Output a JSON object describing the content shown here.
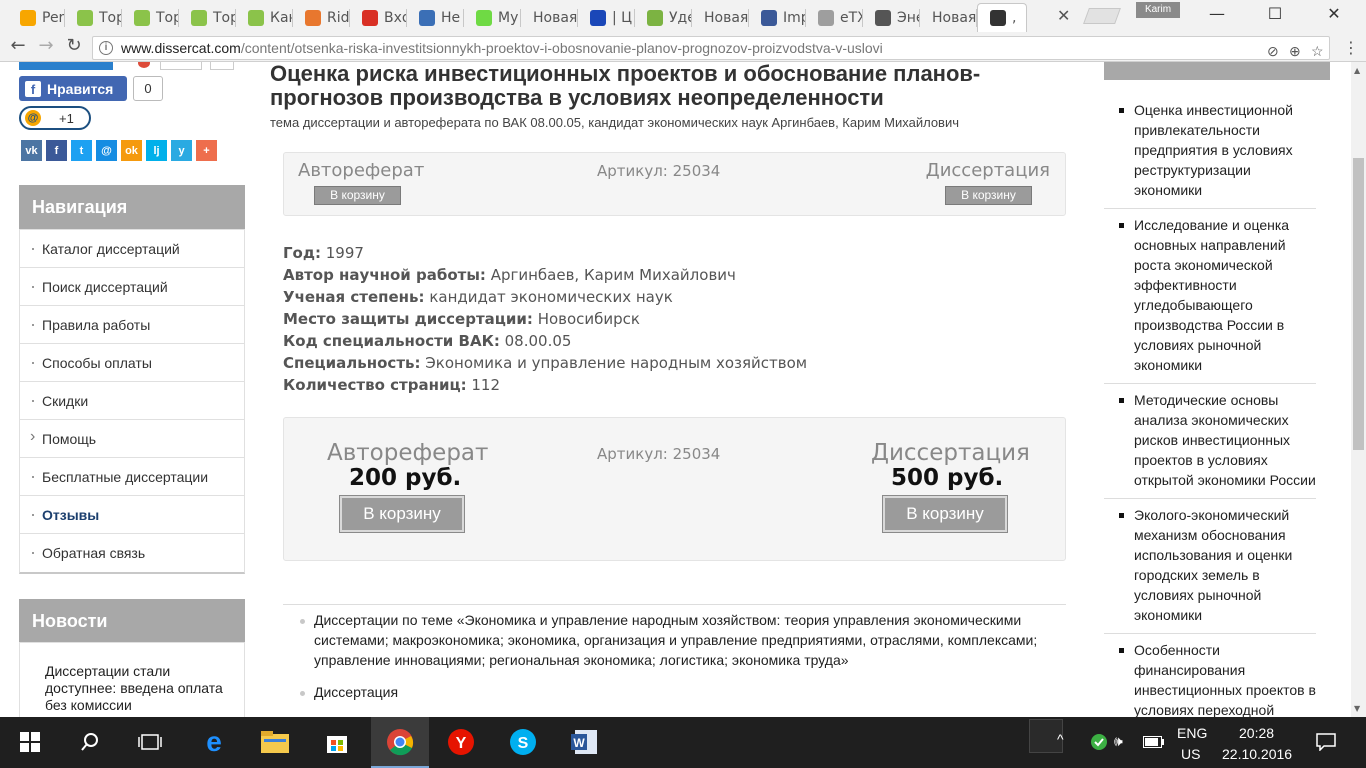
{
  "browser": {
    "tabs": [
      {
        "label": "Per",
        "icon": "at-icon",
        "color": "#f7a600"
      },
      {
        "label": "Тор",
        "icon": "bt-icon",
        "color": "#8bc34a"
      },
      {
        "label": "Тор",
        "icon": "bt-icon",
        "color": "#8bc34a"
      },
      {
        "label": "Тор",
        "icon": "bt-icon",
        "color": "#8bc34a"
      },
      {
        "label": "Кан",
        "icon": "bt-icon",
        "color": "#8bc34a"
      },
      {
        "label": "Rid",
        "icon": "r-icon",
        "color": "#e8772e"
      },
      {
        "label": "Вхо",
        "icon": "gmail-icon",
        "color": "#d93025"
      },
      {
        "label": "Не",
        "icon": "z-icon",
        "color": "#3b6fb6"
      },
      {
        "label": "My",
        "icon": "up-icon",
        "color": "#6fda44"
      },
      {
        "label": "Новая",
        "icon": "",
        "color": ""
      },
      {
        "label": "| Ц",
        "icon": "ca-icon",
        "color": "#1a47b8"
      },
      {
        "label": "Уде",
        "icon": "ru-icon",
        "color": "#7cb342"
      },
      {
        "label": "Новая",
        "icon": "",
        "color": ""
      },
      {
        "label": "Imp",
        "icon": "facebook-icon",
        "color": "#3b5998"
      },
      {
        "label": "eTX",
        "icon": "doc-icon",
        "color": "#9e9e9e"
      },
      {
        "label": "Эне",
        "icon": "book-icon",
        "color": "#555555"
      },
      {
        "label": "Новая",
        "icon": "",
        "color": ""
      },
      {
        "label": ",",
        "icon": "page-icon",
        "color": "#333333"
      }
    ],
    "profile": "Karim",
    "url_host": "www.dissercat.com",
    "url_path": "/content/otsenka-riska-investitsionnykh-proektov-i-obosnovanie-planov-prognozov-proizvodstva-v-uslovi"
  },
  "social": {
    "like_label": "Нравится",
    "like_count": "0",
    "plus_label": "+1",
    "share": [
      {
        "label": "vk",
        "color": "#4c75a3"
      },
      {
        "label": "f",
        "color": "#3b5998"
      },
      {
        "label": "t",
        "color": "#1da1f2"
      },
      {
        "label": "@",
        "color": "#168de2"
      },
      {
        "label": "ok",
        "color": "#f59a0e"
      },
      {
        "label": "lj",
        "color": "#00b0ea"
      },
      {
        "label": "y",
        "color": "#2aaae2"
      },
      {
        "label": "+",
        "color": "#ee6e4d"
      }
    ]
  },
  "navigation": {
    "heading": "Навигация",
    "items": [
      "Каталог диссертаций",
      "Поиск диссертаций",
      "Правила работы",
      "Способы оплаты",
      "Скидки",
      "Помощь",
      "Бесплатные диссертации",
      "Отзывы",
      "Обратная связь"
    ]
  },
  "news": {
    "heading": "Новости",
    "item": "Диссертации стали доступнее: введена оплата без комиссии"
  },
  "article": {
    "title": "Оценка риска инвестиционных проектов и обоснование планов-прогнозов производства в условиях неопределенности",
    "subtitle": "тема диссертации и автореферата по ВАК 08.00.05, кандидат экономических наук Аргинбаев, Карим Михайлович",
    "abstract_label": "Автореферат",
    "dissertation_label": "Диссертация",
    "article_no": "Артикул: 25034",
    "cart_label": "В корзину",
    "abstract_price": "200 руб.",
    "dissertation_price": "500 руб.",
    "meta": [
      {
        "k": "Год:",
        "v": "1997"
      },
      {
        "k": "Автор научной работы:",
        "v": "Аргинбаев, Карим Михайлович"
      },
      {
        "k": "Ученая степень:",
        "v": "кандидат экономических наук"
      },
      {
        "k": "Место защиты диссертации:",
        "v": "Новосибирск"
      },
      {
        "k": "Код специальности ВАК:",
        "v": "08.00.05"
      },
      {
        "k": "Специальность:",
        "v": "Экономика и управление народным хозяйством"
      },
      {
        "k": "Количество страниц:",
        "v": "112"
      }
    ],
    "bullets": [
      "Диссертации по теме «Экономика и управление народным хозяйством: теория управления экономическими системами; макроэкономика; экономика, организация и управление предприятиями, отраслями, комплексами; управление инновациями; региональная экономика; логистика; экономика труда»",
      "Диссертация"
    ]
  },
  "related": [
    "Оценка инвестиционной привлекательности предприятия в условиях реструктуризации экономики",
    "Исследование и оценка основных направлений роста экономической эффективности угледобывающего производства России в условиях рыночной экономики",
    "Методические основы анализа экономических рисков инвестиционных проектов в условиях открытой экономики России",
    "Эколого-экономический механизм обоснования использования и оценки городских земель в условиях рыночной экономики",
    "Особенности финансирования инвестиционных проектов в условиях переходной экономики :На примере"
  ],
  "taskbar": {
    "lang1": "ENG",
    "lang2": "US",
    "time": "20:28",
    "date": "22.10.2016"
  }
}
